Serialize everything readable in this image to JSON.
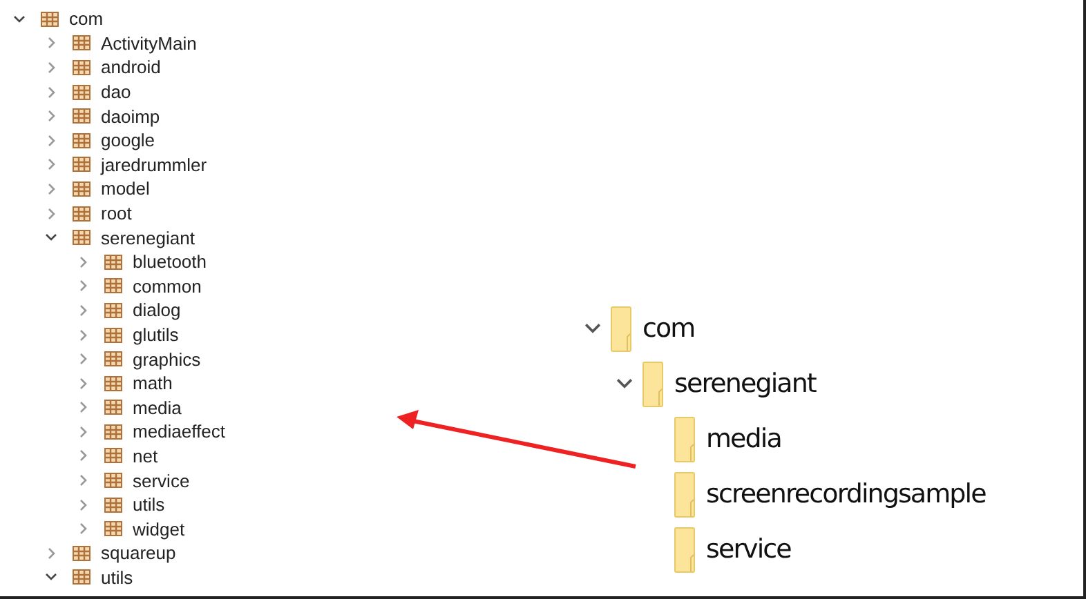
{
  "package_tree": [
    {
      "label": "com",
      "expanded": true,
      "children": [
        {
          "label": "ActivityMain",
          "expanded": false
        },
        {
          "label": "android",
          "expanded": false
        },
        {
          "label": "dao",
          "expanded": false
        },
        {
          "label": "daoimp",
          "expanded": false
        },
        {
          "label": "google",
          "expanded": false
        },
        {
          "label": "jaredrummler",
          "expanded": false
        },
        {
          "label": "model",
          "expanded": false
        },
        {
          "label": "root",
          "expanded": false
        },
        {
          "label": "serenegiant",
          "expanded": true,
          "children": [
            {
              "label": "bluetooth",
              "expanded": false
            },
            {
              "label": "common",
              "expanded": false
            },
            {
              "label": "dialog",
              "expanded": false
            },
            {
              "label": "glutils",
              "expanded": false
            },
            {
              "label": "graphics",
              "expanded": false
            },
            {
              "label": "math",
              "expanded": false
            },
            {
              "label": "media",
              "expanded": false
            },
            {
              "label": "mediaeffect",
              "expanded": false
            },
            {
              "label": "net",
              "expanded": false
            },
            {
              "label": "service",
              "expanded": false
            },
            {
              "label": "utils",
              "expanded": false
            },
            {
              "label": "widget",
              "expanded": false
            }
          ]
        },
        {
          "label": "squareup",
          "expanded": false
        },
        {
          "label": "utils",
          "expanded": true
        }
      ]
    }
  ],
  "folder_tree": [
    {
      "label": "com",
      "expanded": true,
      "children": [
        {
          "label": "serenegiant",
          "expanded": true,
          "children": [
            {
              "label": "media"
            },
            {
              "label": "screenrecordingsample"
            },
            {
              "label": "service"
            }
          ]
        }
      ]
    }
  ]
}
